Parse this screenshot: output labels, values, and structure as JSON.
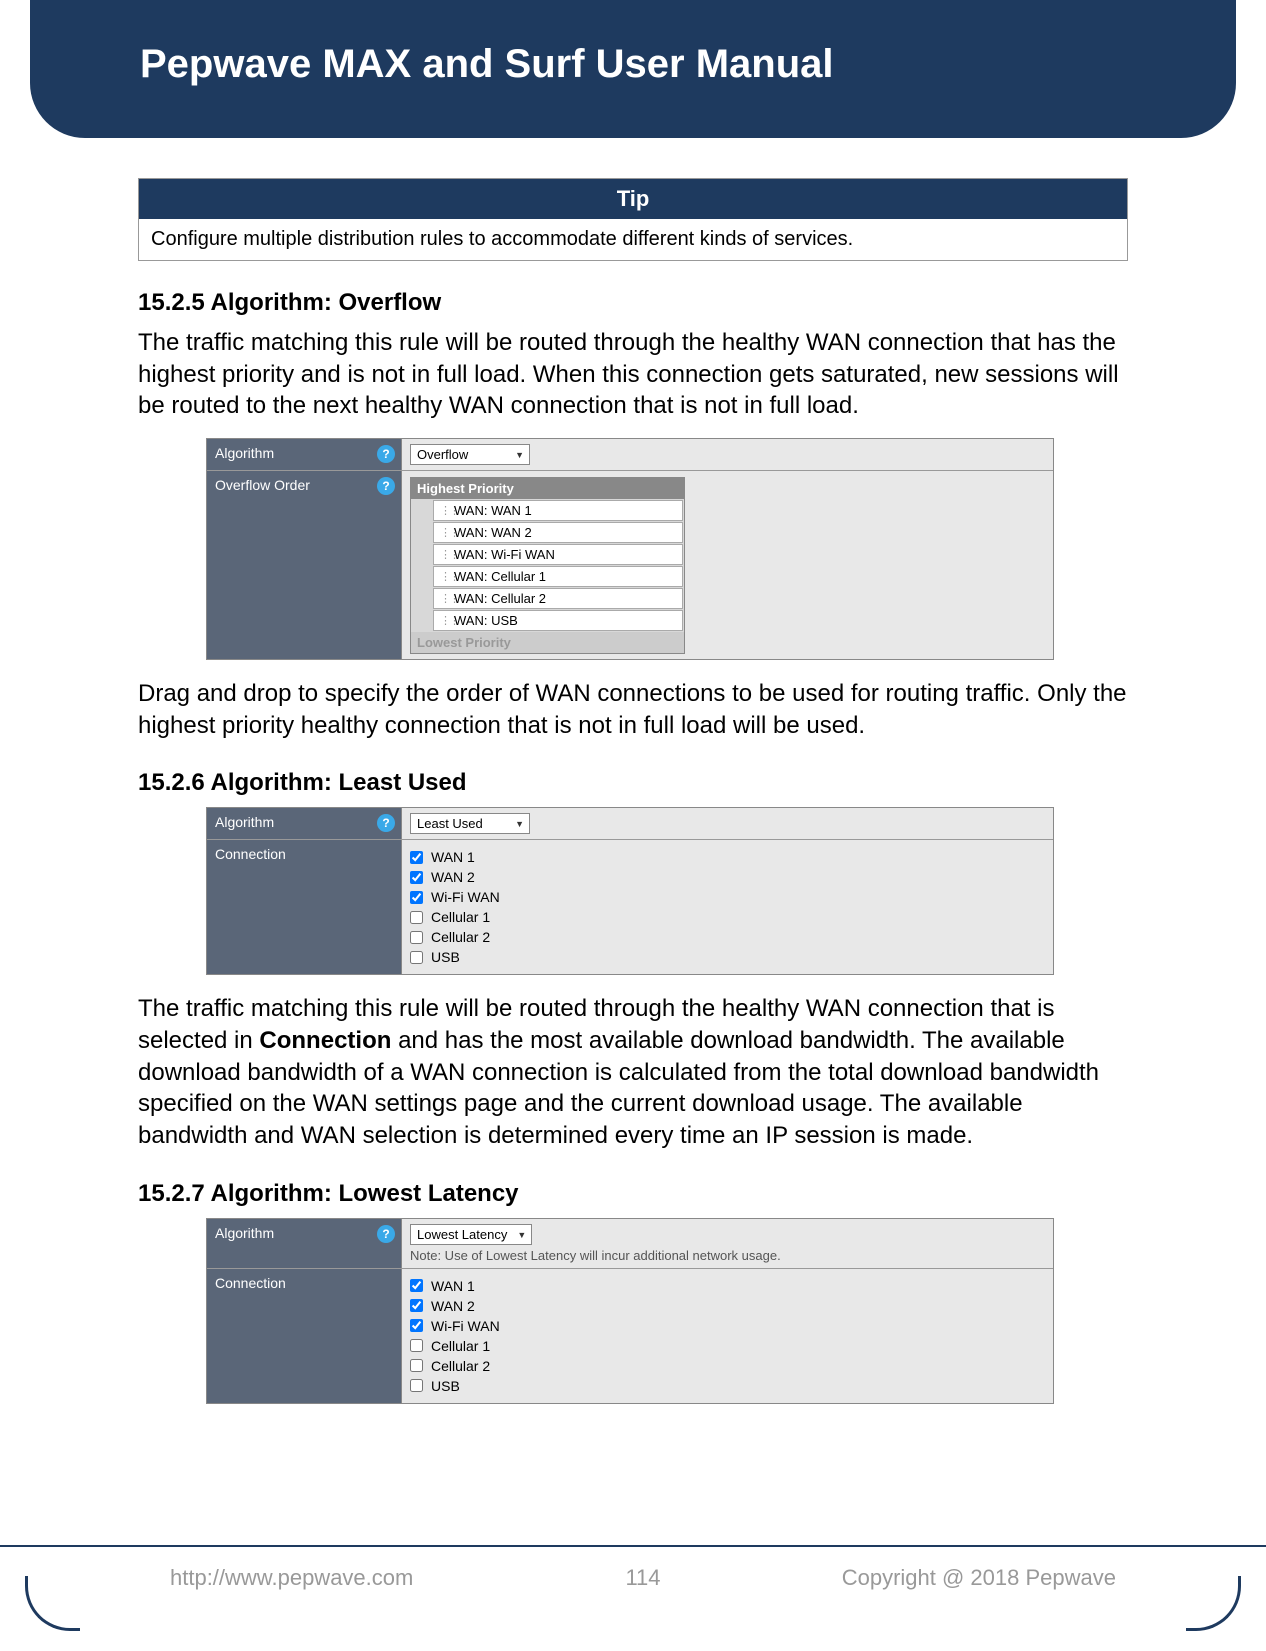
{
  "title": "Pepwave MAX and Surf User Manual",
  "tip": {
    "header": "Tip",
    "body": "Configure multiple distribution rules to accommodate different kinds of services."
  },
  "s1": {
    "heading": "15.2.5 Algorithm: Overflow",
    "p1": "The traffic matching this rule will be routed through the healthy WAN connection that has the highest priority and is not in full load. When this connection gets saturated, new sessions will be routed to the next healthy WAN connection that is not in full load.",
    "algo_label": "Algorithm",
    "algo_value": "Overflow",
    "order_label": "Overflow Order",
    "highest": "Highest Priority",
    "lowest": "Lowest Priority",
    "wans": [
      "WAN: WAN 1",
      "WAN: WAN 2",
      "WAN: Wi-Fi WAN",
      "WAN: Cellular 1",
      "WAN: Cellular 2",
      "WAN: USB"
    ],
    "p2": "Drag and drop to specify the order of WAN connections to be used for routing traffic. Only the highest priority healthy connection that is not in full load will be used."
  },
  "s2": {
    "heading": "15.2.6 Algorithm: Least Used",
    "algo_label": "Algorithm",
    "algo_value": "Least Used",
    "conn_label": "Connection",
    "conns": [
      {
        "label": "WAN 1",
        "checked": true
      },
      {
        "label": "WAN 2",
        "checked": true
      },
      {
        "label": "Wi-Fi WAN",
        "checked": true
      },
      {
        "label": "Cellular 1",
        "checked": false
      },
      {
        "label": "Cellular 2",
        "checked": false
      },
      {
        "label": "USB",
        "checked": false
      }
    ],
    "p_pre": "The traffic matching this rule will be routed through the healthy WAN connection that is selected in ",
    "p_bold": "Connection",
    "p_post": " and has the most available download bandwidth. The available download bandwidth of a WAN connection is calculated from the total download bandwidth specified on the WAN settings page and the current download usage. The available bandwidth and WAN selection is determined every time an IP session is made."
  },
  "s3": {
    "heading": "15.2.7 Algorithm: Lowest Latency",
    "algo_label": "Algorithm",
    "algo_value": "Lowest Latency",
    "note": "Note: Use of Lowest Latency will incur additional network usage.",
    "conn_label": "Connection",
    "conns": [
      {
        "label": "WAN 1",
        "checked": true
      },
      {
        "label": "WAN 2",
        "checked": true
      },
      {
        "label": "Wi-Fi WAN",
        "checked": true
      },
      {
        "label": "Cellular 1",
        "checked": false
      },
      {
        "label": "Cellular 2",
        "checked": false
      },
      {
        "label": "USB",
        "checked": false
      }
    ]
  },
  "footer": {
    "url": "http://www.pepwave.com",
    "page": "114",
    "copy": "Copyright @ 2018 Pepwave"
  }
}
